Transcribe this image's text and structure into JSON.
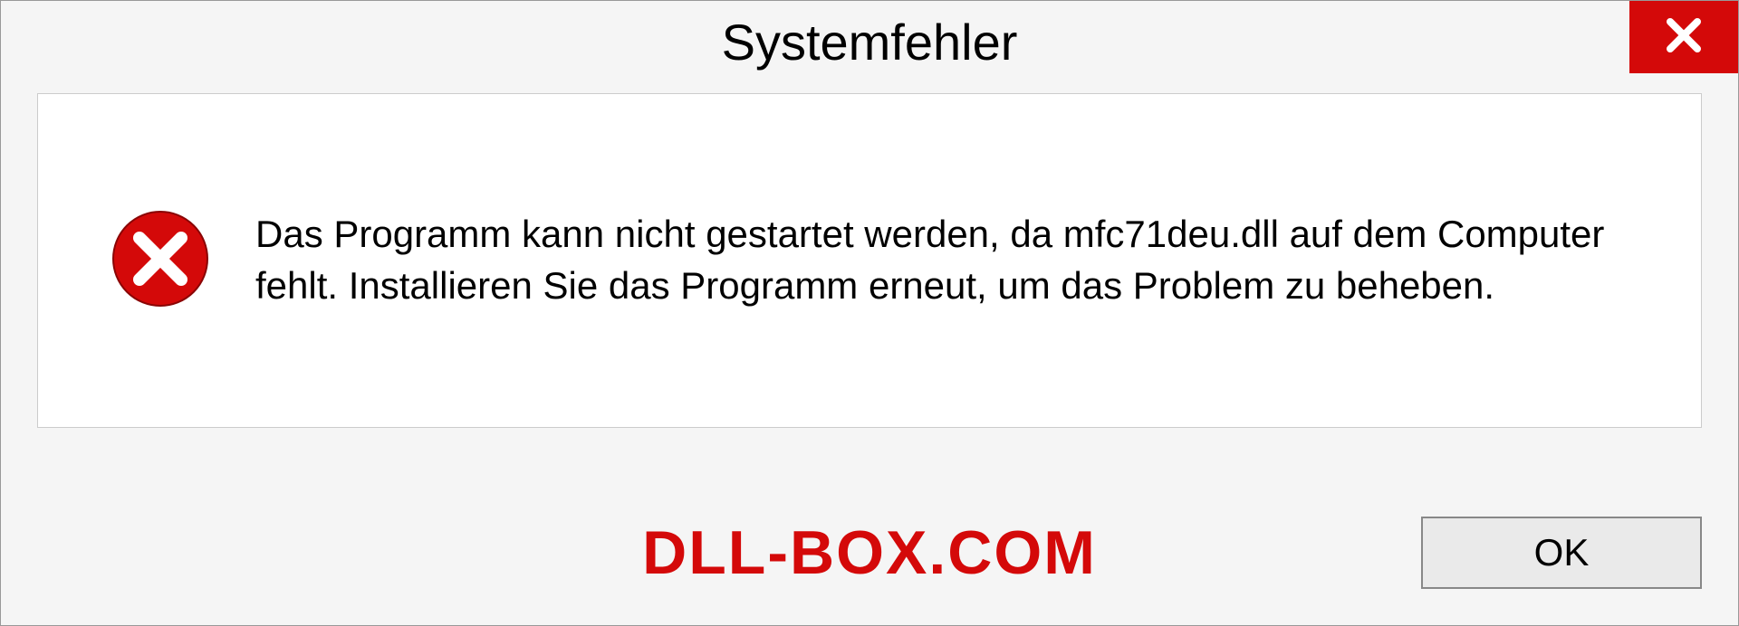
{
  "dialog": {
    "title": "Systemfehler",
    "message": "Das Programm kann nicht gestartet werden, da mfc71deu.dll auf dem Computer fehlt. Installieren Sie das Programm erneut, um das Problem zu beheben.",
    "ok_label": "OK",
    "watermark": "DLL-BOX.COM"
  }
}
